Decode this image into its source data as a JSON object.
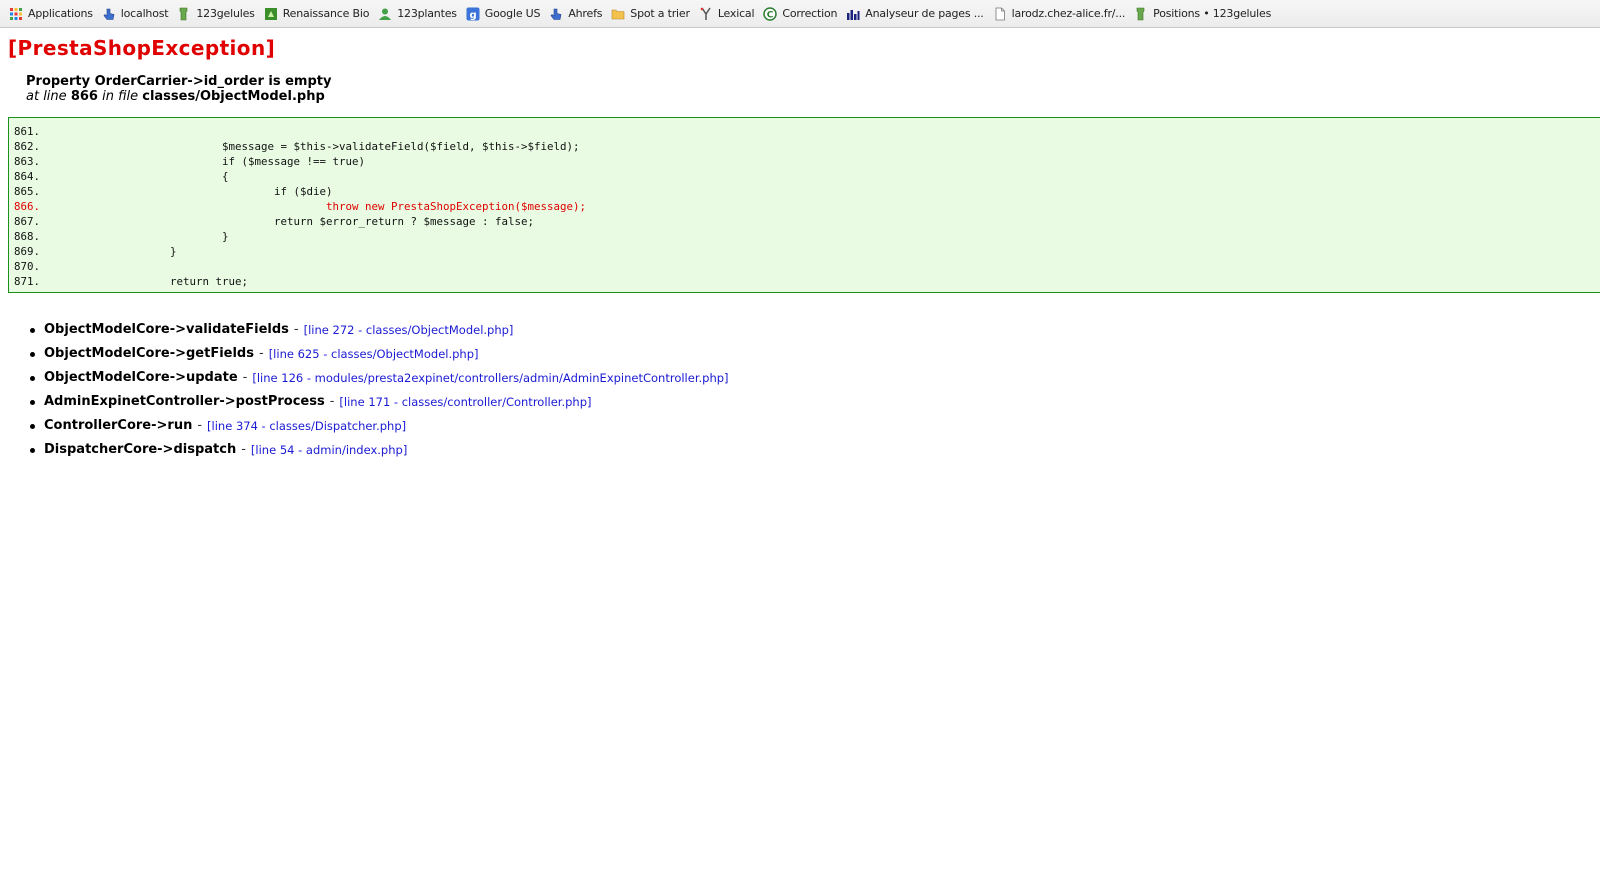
{
  "bookmarks": [
    {
      "label": "Applications",
      "icon": "apps-grid-icon"
    },
    {
      "label": "localhost",
      "icon": "pointer-hand-icon"
    },
    {
      "label": "123gelules",
      "icon": "green-tag-icon"
    },
    {
      "label": "Renaissance Bio",
      "icon": "green-square-icon"
    },
    {
      "label": "123plantes",
      "icon": "user-green-icon"
    },
    {
      "label": "Google US",
      "icon": "google-icon"
    },
    {
      "label": "Ahrefs",
      "icon": "pointer-hand-icon"
    },
    {
      "label": "Spot a trier",
      "icon": "folder-icon"
    },
    {
      "label": "Lexical",
      "icon": "fork-icon"
    },
    {
      "label": "Correction",
      "icon": "copyright-icon"
    },
    {
      "label": "Analyseur de pages ...",
      "icon": "bar-chart-icon"
    },
    {
      "label": "larodz.chez-alice.fr/...",
      "icon": "page-icon"
    },
    {
      "label": "Positions • 123gelules",
      "icon": "green-tag-icon"
    }
  ],
  "exception": {
    "title": "[PrestaShopException]",
    "message": "Property OrderCarrier->id_order is empty",
    "at_line_label": "at line",
    "line": "866",
    "in_file_label": "in file",
    "file": "classes/ObjectModel.php"
  },
  "code_lines": [
    {
      "num": "861.",
      "code": ""
    },
    {
      "num": "862.",
      "code": "\t\t\t$message = $this->validateField($field, $this->$field);"
    },
    {
      "num": "863.",
      "code": "\t\t\tif ($message !== true)"
    },
    {
      "num": "864.",
      "code": "\t\t\t{"
    },
    {
      "num": "865.",
      "code": "\t\t\t\tif ($die)"
    },
    {
      "num": "866.",
      "code": "\t\t\t\t\tthrow new PrestaShopException($message);"
    },
    {
      "num": "867.",
      "code": "\t\t\t\treturn $error_return ? $message : false;"
    },
    {
      "num": "868.",
      "code": "\t\t\t}"
    },
    {
      "num": "869.",
      "code": "\t\t}"
    },
    {
      "num": "870.",
      "code": ""
    },
    {
      "num": "871.",
      "code": "\t\treturn true;"
    }
  ],
  "highlighted_line": "866.",
  "colors": {
    "title": "#e00000",
    "code_bg": "#e9fce3",
    "code_border": "#1b8f1b",
    "link": "#1a1ad4"
  },
  "trace": [
    {
      "fn": "ObjectModelCore->validateFields",
      "sep": "-",
      "link": "[line 272 - classes/ObjectModel.php]"
    },
    {
      "fn": "ObjectModelCore->getFields",
      "sep": "-",
      "link": "[line 625 - classes/ObjectModel.php]"
    },
    {
      "fn": "ObjectModelCore->update",
      "sep": "-",
      "link": "[line 126 - modules/presta2expinet/controllers/admin/AdminExpinetController.php]"
    },
    {
      "fn": "AdminExpinetController->postProcess",
      "sep": "-",
      "link": "[line 171 - classes/controller/Controller.php]"
    },
    {
      "fn": "ControllerCore->run",
      "sep": "-",
      "link": "[line 374 - classes/Dispatcher.php]"
    },
    {
      "fn": "DispatcherCore->dispatch",
      "sep": "-",
      "link": "[line 54 - admin/index.php]"
    }
  ]
}
